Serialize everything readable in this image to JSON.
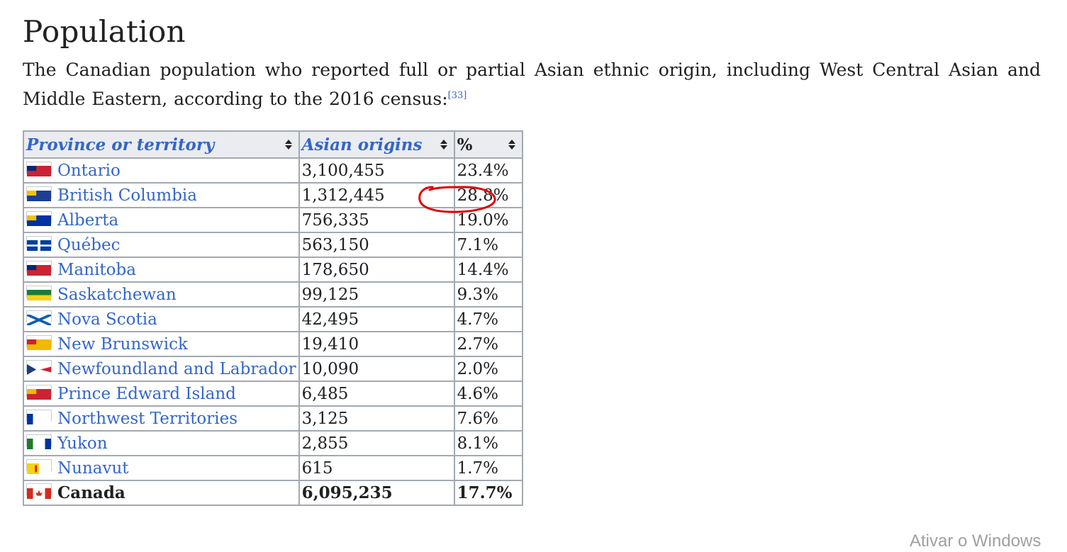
{
  "section": {
    "heading": "Population",
    "intro_text": "The Canadian population who reported full or partial Asian ethnic origin, including West Central Asian and Middle Eastern, according to the 2016 census:",
    "citation": "[33]"
  },
  "table": {
    "columns": [
      {
        "label": "Province or territory",
        "sortable": true
      },
      {
        "label": "Asian origins",
        "sortable": true
      },
      {
        "label": "%",
        "sortable": true
      }
    ],
    "rows": [
      {
        "name": "Ontario",
        "origins": "3,100,455",
        "percent": "23.4%",
        "flag": "ontario-flag-icon",
        "flag_colors": [
          "#cc2233",
          "#002877"
        ]
      },
      {
        "name": "British Columbia",
        "origins": "1,312,445",
        "percent": "28.8%",
        "flag": "british-columbia-flag-icon",
        "flag_colors": [
          "#1c3f94",
          "#f3c300"
        ]
      },
      {
        "name": "Alberta",
        "origins": "756,335",
        "percent": "19.0%",
        "flag": "alberta-flag-icon",
        "flag_colors": [
          "#0032a0",
          "#f3c300"
        ]
      },
      {
        "name": "Québec",
        "origins": "563,150",
        "percent": "7.1%",
        "flag": "quebec-flag-icon",
        "flag_colors": [
          "#003da5",
          "#ffffff"
        ]
      },
      {
        "name": "Manitoba",
        "origins": "178,650",
        "percent": "14.4%",
        "flag": "manitoba-flag-icon",
        "flag_colors": [
          "#cc2233",
          "#002877"
        ]
      },
      {
        "name": "Saskatchewan",
        "origins": "99,125",
        "percent": "9.3%",
        "flag": "saskatchewan-flag-icon",
        "flag_colors": [
          "#1a7a3b",
          "#f7d117"
        ]
      },
      {
        "name": "Nova Scotia",
        "origins": "42,495",
        "percent": "4.7%",
        "flag": "nova-scotia-flag-icon",
        "flag_colors": [
          "#005eb8",
          "#ffffff"
        ]
      },
      {
        "name": "New Brunswick",
        "origins": "19,410",
        "percent": "2.7%",
        "flag": "new-brunswick-flag-icon",
        "flag_colors": [
          "#f2b900",
          "#cc2233"
        ]
      },
      {
        "name": "Newfoundland and Labrador",
        "origins": "10,090",
        "percent": "2.0%",
        "flag": "newfoundland-flag-icon",
        "flag_colors": [
          "#1d3c7a",
          "#cc2233"
        ]
      },
      {
        "name": "Prince Edward Island",
        "origins": "6,485",
        "percent": "4.6%",
        "flag": "pei-flag-icon",
        "flag_colors": [
          "#cc2233",
          "#f2b900"
        ]
      },
      {
        "name": "Northwest Territories",
        "origins": "3,125",
        "percent": "7.6%",
        "flag": "northwest-territories-flag-icon",
        "flag_colors": [
          "#0033a0",
          "#ffffff"
        ]
      },
      {
        "name": "Yukon",
        "origins": "2,855",
        "percent": "8.1%",
        "flag": "yukon-flag-icon",
        "flag_colors": [
          "#1c7a2e",
          "#0033a0"
        ]
      },
      {
        "name": "Nunavut",
        "origins": "615",
        "percent": "1.7%",
        "flag": "nunavut-flag-icon",
        "flag_colors": [
          "#f8d20f",
          "#cc2233"
        ]
      }
    ],
    "total": {
      "name": "Canada",
      "origins": "6,095,235",
      "percent": "17.7%",
      "flag": "canada-flag-icon",
      "flag_colors": [
        "#d52b1e",
        "#ffffff"
      ]
    }
  },
  "annotation": {
    "highlighted_value": "28.8%",
    "circle_color": "#e00000"
  },
  "os_overlay": {
    "watermark": "Ativar o Windows"
  },
  "colors": {
    "link": "#3366cc",
    "header_bg": "#eaecf0",
    "border": "#a2a9b1"
  }
}
